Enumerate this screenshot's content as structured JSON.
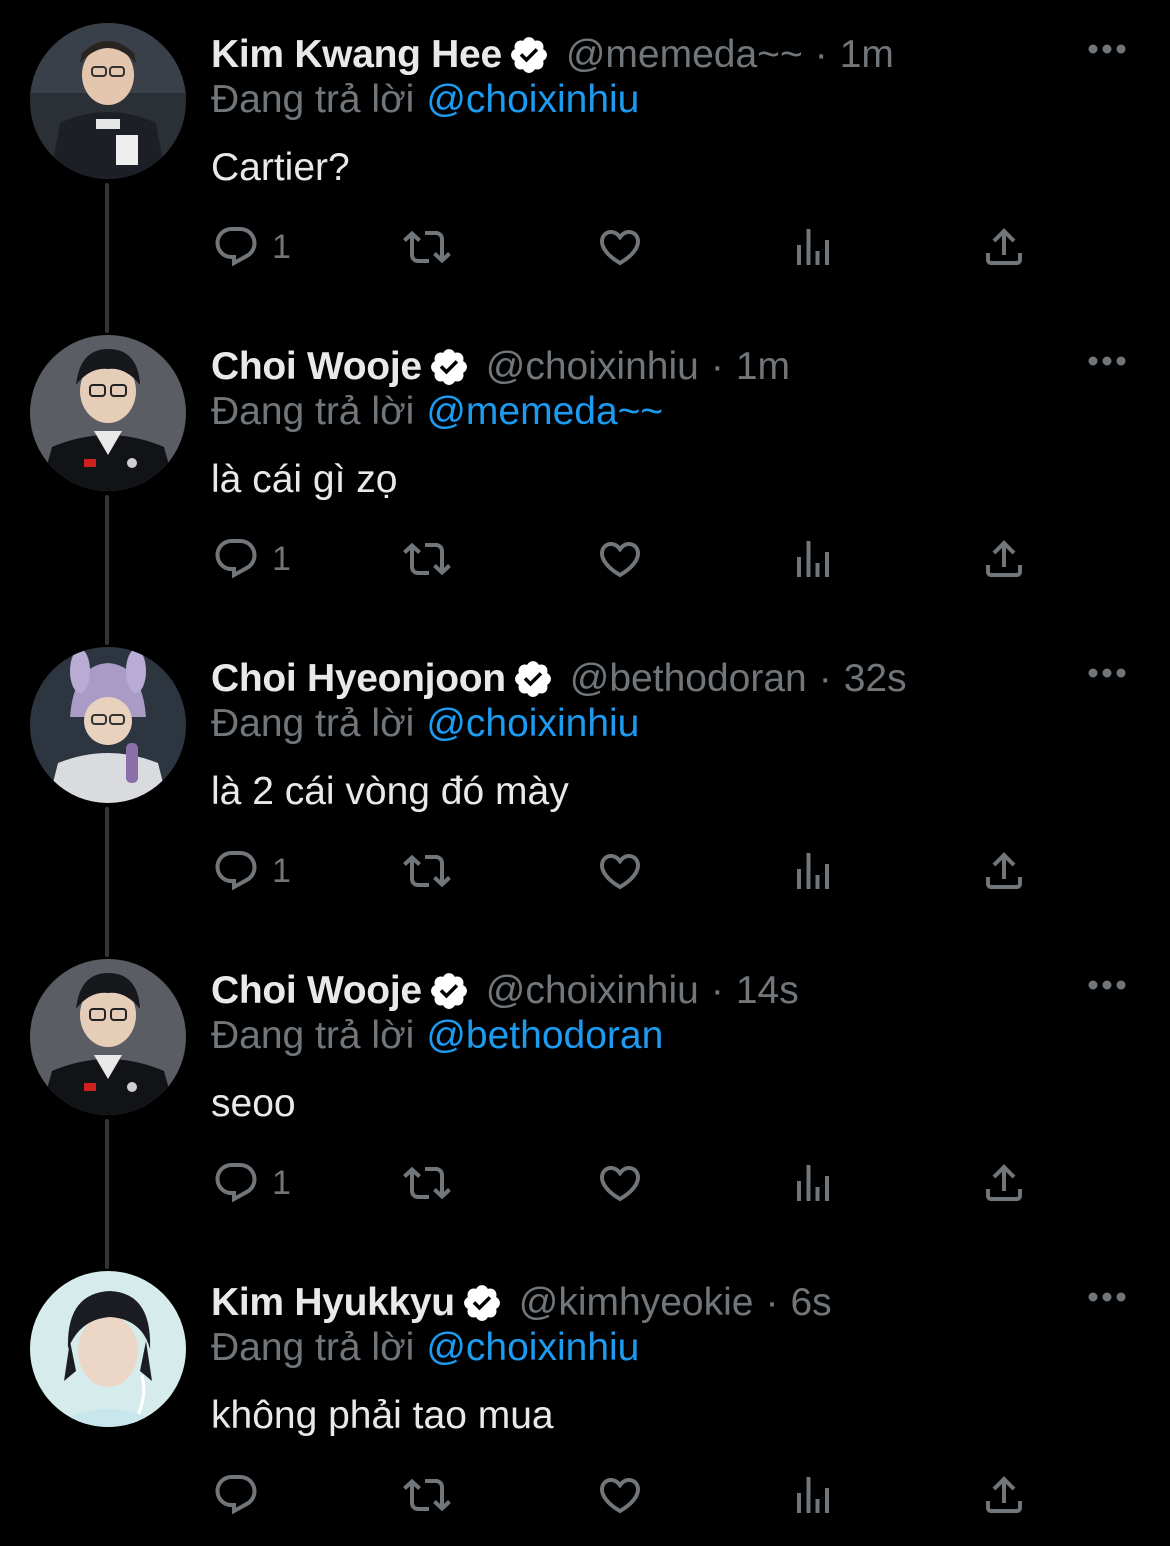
{
  "reply_prefix": "Đang trả lời",
  "tweets": [
    {
      "display_name": "Kim Kwang Hee",
      "handle": "@memeda~~",
      "time": "1m",
      "reply_to": "@choixinhiu",
      "text": "Cartier?",
      "reply_count": "1",
      "avatar": "avatar-kim-kwang-hee"
    },
    {
      "display_name": "Choi Wooje",
      "handle": "@choixinhiu",
      "time": "1m",
      "reply_to": "@memeda~~",
      "text": "là cái gì zọ",
      "reply_count": "1",
      "avatar": "avatar-choi-wooje"
    },
    {
      "display_name": "Choi Hyeonjoon",
      "handle": "@bethodoran",
      "time": "32s",
      "reply_to": "@choixinhiu",
      "text": "là 2 cái vòng đó mày",
      "reply_count": "1",
      "avatar": "avatar-choi-hyeonjoon"
    },
    {
      "display_name": "Choi Wooje",
      "handle": "@choixinhiu",
      "time": "14s",
      "reply_to": "@bethodoran",
      "text": "seoo",
      "reply_count": "1",
      "avatar": "avatar-choi-wooje"
    },
    {
      "display_name": "Kim Hyukkyu",
      "handle": "@kimhyeokie",
      "time": "6s",
      "reply_to": "@choixinhiu",
      "text": "không phải tao mua",
      "reply_count": "",
      "avatar": "avatar-kim-hyukkyu"
    }
  ],
  "colors": {
    "background": "#000000",
    "name": "#e7e9ea",
    "muted": "#71767b",
    "link": "#1d9bf0",
    "thread_line": "#333639"
  },
  "icons": [
    "verified-badge-icon",
    "more-icon",
    "reply-icon",
    "retweet-icon",
    "like-icon",
    "views-icon",
    "share-icon"
  ]
}
